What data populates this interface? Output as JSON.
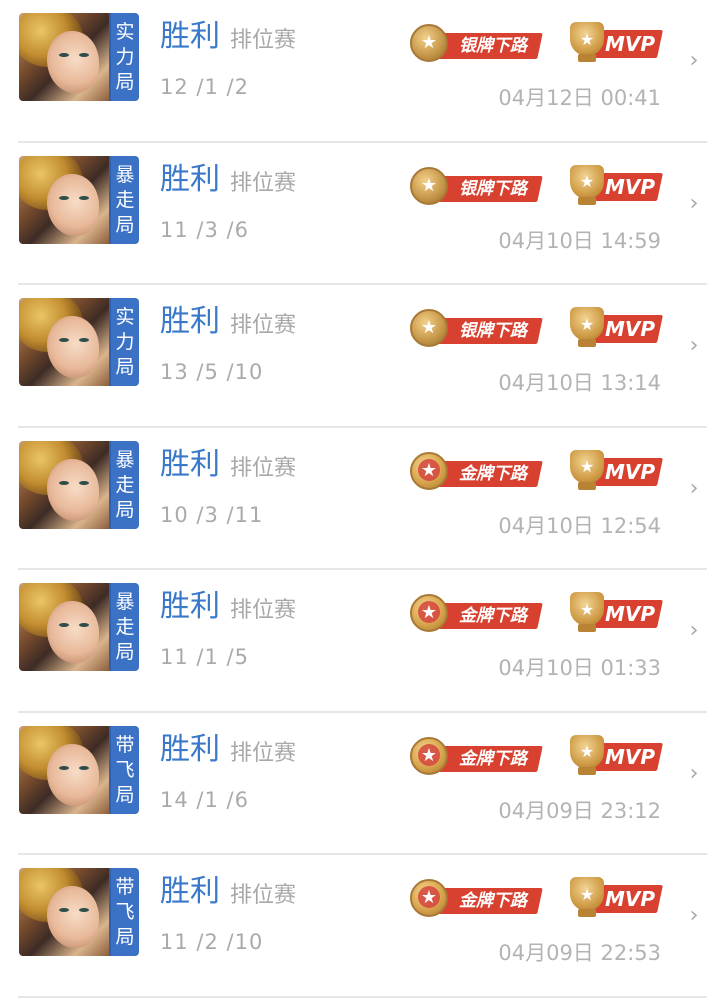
{
  "matches": [
    {
      "tag": [
        "实",
        "力",
        "局"
      ],
      "result": "胜利",
      "mode": "排位赛",
      "kda": "12 /1 /2",
      "rank_badge": "银牌下路",
      "rank_tier": "silver",
      "mvp": "MVP",
      "time": "04月12日 00:41"
    },
    {
      "tag": [
        "暴",
        "走",
        "局"
      ],
      "result": "胜利",
      "mode": "排位赛",
      "kda": "11 /3 /6",
      "rank_badge": "银牌下路",
      "rank_tier": "silver",
      "mvp": "MVP",
      "time": "04月10日 14:59"
    },
    {
      "tag": [
        "实",
        "力",
        "局"
      ],
      "result": "胜利",
      "mode": "排位赛",
      "kda": "13 /5 /10",
      "rank_badge": "银牌下路",
      "rank_tier": "silver",
      "mvp": "MVP",
      "time": "04月10日 13:14"
    },
    {
      "tag": [
        "暴",
        "走",
        "局"
      ],
      "result": "胜利",
      "mode": "排位赛",
      "kda": "10 /3 /11",
      "rank_badge": "金牌下路",
      "rank_tier": "gold",
      "mvp": "MVP",
      "time": "04月10日 12:54"
    },
    {
      "tag": [
        "暴",
        "走",
        "局"
      ],
      "result": "胜利",
      "mode": "排位赛",
      "kda": "11 /1 /5",
      "rank_badge": "金牌下路",
      "rank_tier": "gold",
      "mvp": "MVP",
      "time": "04月10日 01:33"
    },
    {
      "tag": [
        "带",
        "飞",
        "局"
      ],
      "result": "胜利",
      "mode": "排位赛",
      "kda": "14 /1 /6",
      "rank_badge": "金牌下路",
      "rank_tier": "gold",
      "mvp": "MVP",
      "time": "04月09日 23:12"
    },
    {
      "tag": [
        "带",
        "飞",
        "局"
      ],
      "result": "胜利",
      "mode": "排位赛",
      "kda": "11 /2 /10",
      "rank_badge": "金牌下路",
      "rank_tier": "gold",
      "mvp": "MVP",
      "time": "04月09日 22:53"
    }
  ],
  "icons": {
    "star": "★",
    "chevron": "›"
  },
  "colors": {
    "accent_blue": "#3a78c9",
    "tag_blue": "#3b72c6",
    "ribbon_red": "#d8412f",
    "medal_gold": "#cf9b45"
  }
}
